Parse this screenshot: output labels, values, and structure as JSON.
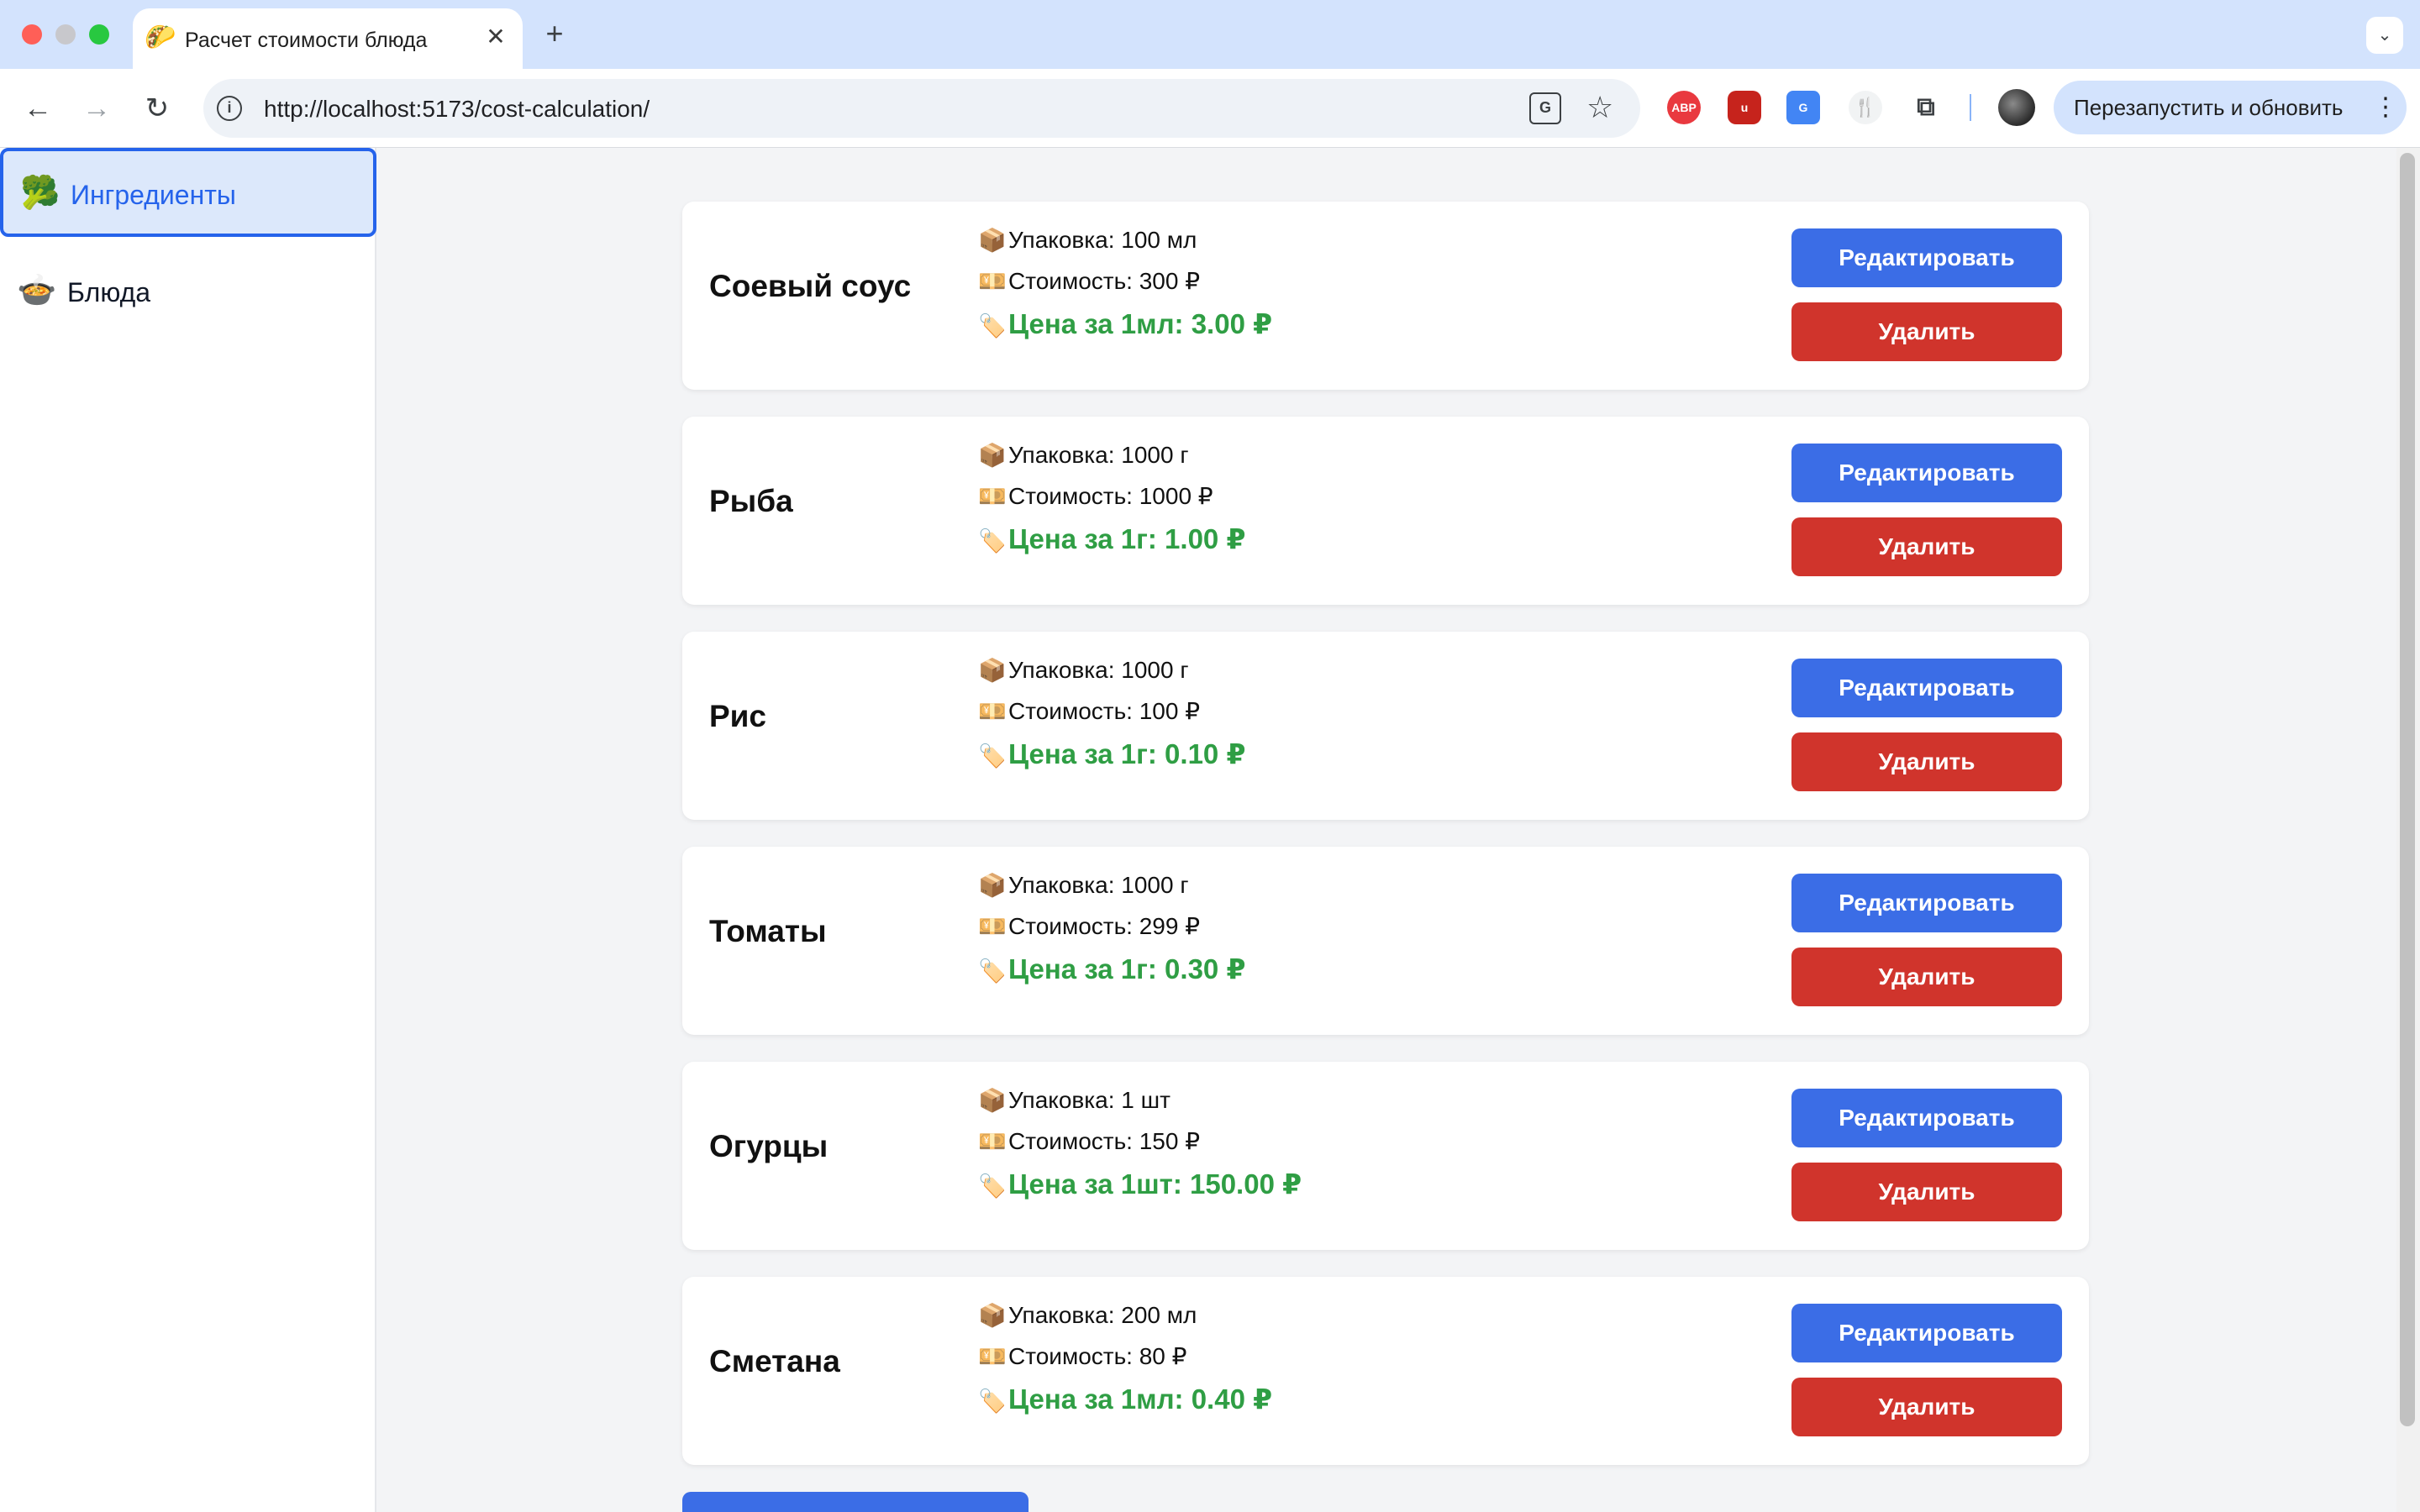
{
  "browser": {
    "tab_title": "Расчет стоимости блюда",
    "tab_favicon": "🌮",
    "url": "http://localhost:5173/cost-calculation/",
    "relaunch_label": "Перезапустить и обновить",
    "extensions": {
      "abp": "ABP",
      "ublock": "u",
      "translate": "G",
      "chef": "🍴"
    }
  },
  "sidebar": {
    "items": [
      {
        "icon": "🥦",
        "label": "Ингредиенты",
        "active": true
      },
      {
        "icon": "🍲",
        "label": "Блюда",
        "active": false
      }
    ]
  },
  "ingredients": [
    {
      "name": "Соевый соус",
      "package": "Упаковка: 100 мл",
      "cost": "Стоимость: 300 ₽",
      "unit_price": "Цена за 1мл: 3.00 ₽"
    },
    {
      "name": "Рыба",
      "package": "Упаковка: 1000 г",
      "cost": "Стоимость: 1000 ₽",
      "unit_price": "Цена за 1г: 1.00 ₽"
    },
    {
      "name": "Рис",
      "package": "Упаковка: 1000 г",
      "cost": "Стоимость: 100 ₽",
      "unit_price": "Цена за 1г: 0.10 ₽"
    },
    {
      "name": "Томаты",
      "package": "Упаковка: 1000 г",
      "cost": "Стоимость: 299 ₽",
      "unit_price": "Цена за 1г: 0.30 ₽"
    },
    {
      "name": "Огурцы",
      "package": "Упаковка: 1 шт",
      "cost": "Стоимость: 150 ₽",
      "unit_price": "Цена за 1шт: 150.00 ₽"
    },
    {
      "name": "Сметана",
      "package": "Упаковка: 200 мл",
      "cost": "Стоимость: 80 ₽",
      "unit_price": "Цена за 1мл: 0.40 ₽"
    }
  ],
  "labels": {
    "edit": "Редактировать",
    "delete": "Удалить"
  },
  "icons": {
    "package": "📦",
    "cost": "💴",
    "price": "🏷️"
  },
  "colors": {
    "accent": "#2563eb",
    "edit_button": "#3b6de6",
    "delete_button": "#d0342c",
    "price_text": "#2f9e44"
  }
}
